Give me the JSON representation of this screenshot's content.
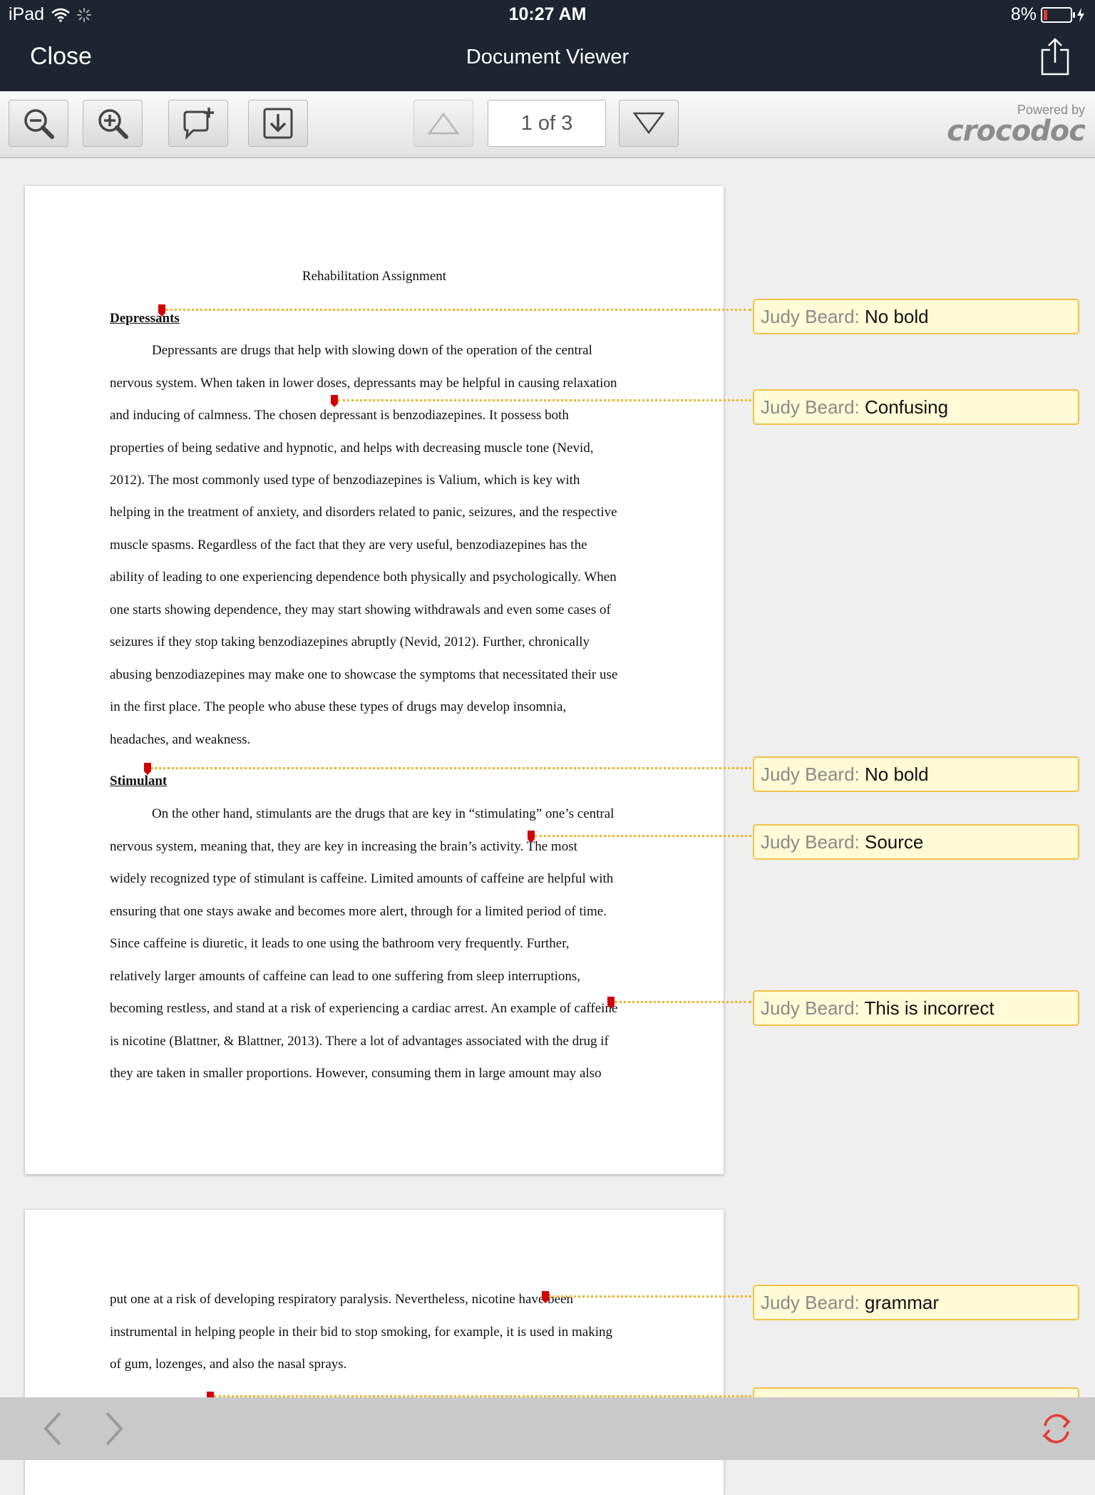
{
  "status_bar": {
    "device": "iPad",
    "time": "10:27 AM",
    "battery": "8%"
  },
  "nav": {
    "close_label": "Close",
    "title": "Document Viewer"
  },
  "toolbar": {
    "page_indicator": "1 of 3",
    "powered_by": "Powered by",
    "brand": "crocodoc"
  },
  "document": {
    "title": "Rehabilitation Assignment",
    "heading1": "Depressants",
    "p1_lines": [
      "Depressants are drugs that help with slowing down of the operation of the central",
      "nervous system. When taken in lower doses, depressants may be helpful in causing relaxation",
      "and inducing of calmness. The chosen depressant is benzodiazepines. It possess both",
      "properties of being sedative and hypnotic, and helps with decreasing muscle tone (Nevid,",
      "2012). The most commonly used type of benzodiazepines is Valium, which is key with",
      "helping in the treatment of anxiety, and disorders related to panic, seizures, and the respective",
      "muscle spasms. Regardless of the fact that they are very useful, benzodiazepines has the",
      "ability of leading to one experiencing dependence both physically and psychologically. When",
      "one starts showing dependence, they may start showing withdrawals and even some cases of",
      "seizures if they stop taking benzodiazepines abruptly (Nevid, 2012). Further, chronically",
      "abusing benzodiazepines may make one to showcase the symptoms that necessitated their use",
      "in the first place. The people who abuse these types of drugs may develop insomnia,",
      "headaches, and weakness."
    ],
    "heading2": "Stimulant",
    "p2_lines": [
      "On the other hand, stimulants are the drugs that are key in “stimulating” one’s central",
      "nervous system, meaning that, they are key in increasing the brain’s activity. The most",
      "widely recognized type of stimulant is caffeine. Limited amounts of caffeine are helpful with",
      "ensuring that one stays awake and becomes more alert, through for a limited period of time.",
      "Since caffeine is diuretic, it leads to one using the bathroom very frequently. Further,",
      "relatively larger amounts of caffeine can lead to one suffering from sleep interruptions,",
      "becoming restless, and stand at a risk of experiencing a cardiac arrest. An example of caffeine",
      "is nicotine (Blattner, & Blattner, 2013). There a lot of advantages associated with the drug if",
      "they are taken in smaller proportions. However, consuming them in large amount may also"
    ],
    "page2_lines": [
      "put one at a risk of developing respiratory paralysis. Nevertheless, nicotine have been",
      "instrumental in helping people in their bid to stop smoking, for example, it is used in making",
      "of gum, lozenges, and also the nasal sprays."
    ]
  },
  "comments": [
    {
      "author": "Judy Beard:",
      "text": "No bold"
    },
    {
      "author": "Judy Beard:",
      "text": "Confusing"
    },
    {
      "author": "Judy Beard:",
      "text": "No bold"
    },
    {
      "author": "Judy Beard:",
      "text": "Source"
    },
    {
      "author": "Judy Beard:",
      "text": "This is incorrect"
    },
    {
      "author": "Judy Beard:",
      "text": "grammar"
    }
  ],
  "icons": [
    "wifi-icon",
    "activity-spinner-icon",
    "battery-icon",
    "charging-icon",
    "share-icon",
    "zoom-out-icon",
    "zoom-in-icon",
    "add-comment-icon",
    "download-icon",
    "page-up-icon",
    "page-down-icon",
    "back-icon",
    "forward-icon",
    "refresh-icon"
  ],
  "colors": {
    "nav_bg": "#1e2430",
    "comment_bg": "#fffbd6",
    "comment_border": "#f0c24a",
    "marker": "#d10000",
    "leader": "#f0b428",
    "refresh": "#e53935"
  }
}
